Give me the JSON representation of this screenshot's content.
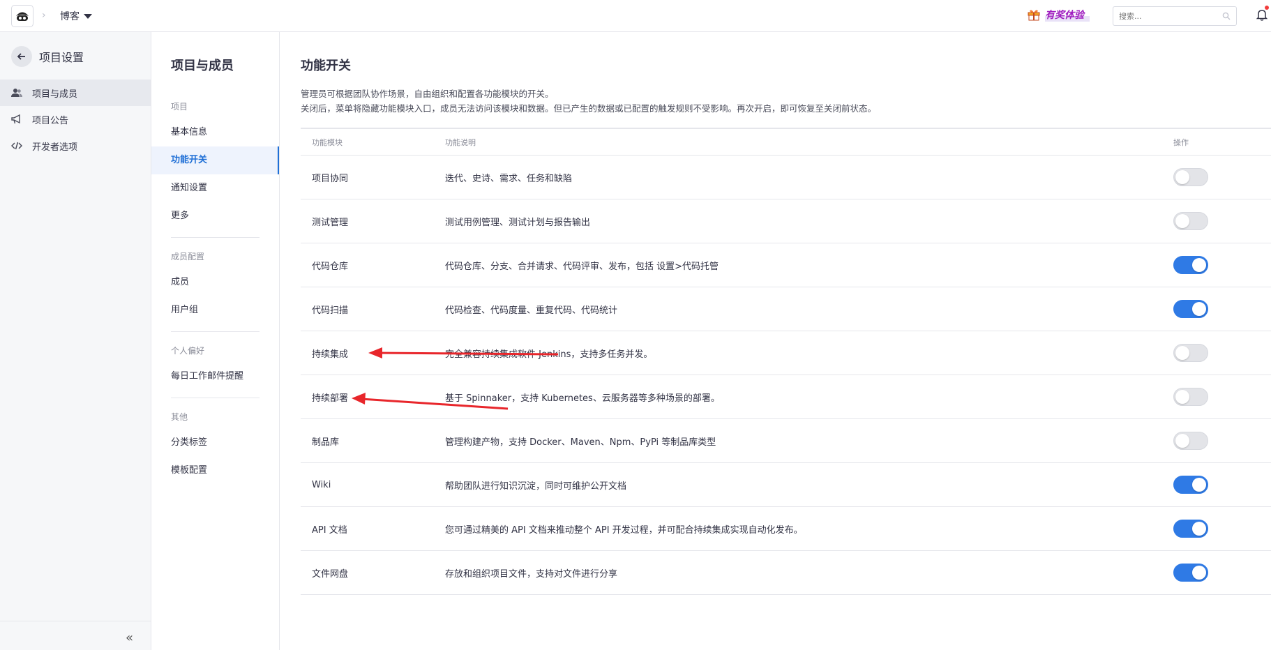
{
  "topbar": {
    "project_name": "博客",
    "promo_label": "有奖体验",
    "search_placeholder": "搜索..."
  },
  "sidebar": {
    "title": "项目设置",
    "items": [
      {
        "label": "项目与成员",
        "icon": "users-icon",
        "active": true
      },
      {
        "label": "项目公告",
        "icon": "megaphone-icon",
        "active": false
      },
      {
        "label": "开发者选项",
        "icon": "code-icon",
        "active": false
      }
    ],
    "collapse_glyph": "«"
  },
  "subnav": {
    "title": "项目与成员",
    "groups": [
      {
        "label": "项目",
        "items": [
          "基本信息",
          "功能开关",
          "通知设置",
          "更多"
        ]
      },
      {
        "label": "成员配置",
        "items": [
          "成员",
          "用户组"
        ]
      },
      {
        "label": "个人偏好",
        "items": [
          "每日工作邮件提醒"
        ]
      },
      {
        "label": "其他",
        "items": [
          "分类标签",
          "模板配置"
        ]
      }
    ],
    "active_item": "功能开关"
  },
  "main": {
    "title": "功能开关",
    "desc_line1": "管理员可根据团队协作场景，自由组织和配置各功能模块的开关。",
    "desc_line2": "关闭后，菜单将隐藏功能模块入口，成员无法访问该模块和数据。但已产生的数据或已配置的触发规则不受影响。再次开启，即可恢复至关闭前状态。",
    "columns": {
      "module": "功能模块",
      "desc": "功能说明",
      "action": "操作"
    },
    "rows": [
      {
        "module": "项目协同",
        "desc": "迭代、史诗、需求、任务和缺陷",
        "enabled": false
      },
      {
        "module": "测试管理",
        "desc": "测试用例管理、测试计划与报告输出",
        "enabled": false
      },
      {
        "module": "代码仓库",
        "desc": "代码仓库、分支、合并请求、代码评审、发布，包括 设置>代码托管",
        "enabled": true
      },
      {
        "module": "代码扫描",
        "desc": "代码检查、代码度量、重复代码、代码统计",
        "enabled": true
      },
      {
        "module": "持续集成",
        "desc": "完全兼容持续集成软件 Jenkins，支持多任务并发。",
        "enabled": false
      },
      {
        "module": "持续部署",
        "desc": "基于 Spinnaker，支持 Kubernetes、云服务器等多种场景的部署。",
        "enabled": false
      },
      {
        "module": "制品库",
        "desc": "管理构建产物，支持 Docker、Maven、Npm、PyPi 等制品库类型",
        "enabled": false
      },
      {
        "module": "Wiki",
        "desc": "帮助团队进行知识沉淀，同时可维护公开文档",
        "enabled": true
      },
      {
        "module": "API 文档",
        "desc": "您可通过精美的 API 文档来推动整个 API 开发过程，并可配合持续集成实现自动化发布。",
        "enabled": true
      },
      {
        "module": "文件网盘",
        "desc": "存放和组织项目文件，支持对文件进行分享",
        "enabled": true
      }
    ]
  },
  "colors": {
    "accent": "#2f7ae5",
    "annotation_arrow": "#e8262b",
    "active_nav": "#1f6fd6"
  }
}
